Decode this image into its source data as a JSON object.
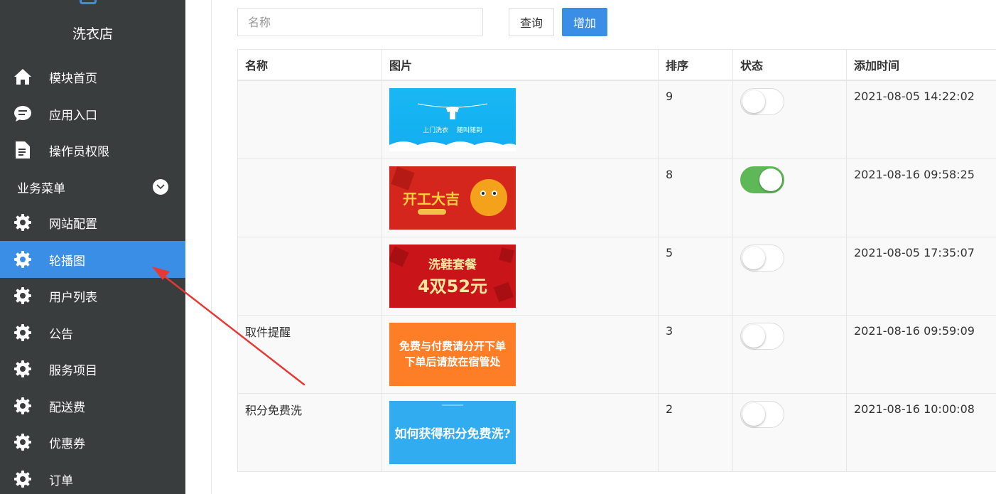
{
  "sidebar": {
    "shop_name": "洗衣店",
    "items": [
      {
        "label": "模块首页",
        "icon": "home-icon"
      },
      {
        "label": "应用入口",
        "icon": "chat-icon"
      },
      {
        "label": "操作员权限",
        "icon": "document-icon"
      }
    ],
    "group_label": "业务菜单",
    "group_items": [
      {
        "label": "网站配置",
        "icon": "gear-icon"
      },
      {
        "label": "轮播图",
        "icon": "gear-icon",
        "active": true
      },
      {
        "label": "用户列表",
        "icon": "gear-icon"
      },
      {
        "label": "公告",
        "icon": "gear-icon"
      },
      {
        "label": "服务项目",
        "icon": "gear-icon"
      },
      {
        "label": "配送费",
        "icon": "gear-icon"
      },
      {
        "label": "优惠券",
        "icon": "gear-icon"
      },
      {
        "label": "订单",
        "icon": "gear-icon"
      }
    ],
    "active_color": "#3a8ee6",
    "bg_color": "#393d3e"
  },
  "toolbar": {
    "search_placeholder": "名称",
    "query_label": "查询",
    "add_label": "增加"
  },
  "table": {
    "headers": [
      "名称",
      "图片",
      "排序",
      "状态",
      "添加时间"
    ],
    "rows": [
      {
        "name": "",
        "banner": {
          "line1": "上门洗衣　 随叫随到",
          "line2": ""
        },
        "sort": "9",
        "status_on": false,
        "time": "2021-08-05 14:22:02"
      },
      {
        "name": "",
        "banner": {
          "line1": "开工大吉",
          "line2": ""
        },
        "sort": "8",
        "status_on": true,
        "time": "2021-08-16 09:58:25"
      },
      {
        "name": "",
        "banner": {
          "line1": "洗鞋套餐",
          "line2": "4双52元"
        },
        "sort": "5",
        "status_on": false,
        "time": "2021-08-05 17:35:07"
      },
      {
        "name": "取件提醒",
        "banner": {
          "line1": "免费与付费请分开下单",
          "line2": "下单后请放在宿管处"
        },
        "sort": "3",
        "status_on": false,
        "time": "2021-08-16 09:59:09"
      },
      {
        "name": "积分免费洗",
        "banner": {
          "line1": "如何获得积分免费洗?",
          "line2": ""
        },
        "sort": "2",
        "status_on": false,
        "time": "2021-08-16 10:00:08"
      }
    ],
    "toggle_on_color": "#5fb857"
  },
  "annotation": {
    "type": "arrow",
    "color": "#e53935"
  }
}
